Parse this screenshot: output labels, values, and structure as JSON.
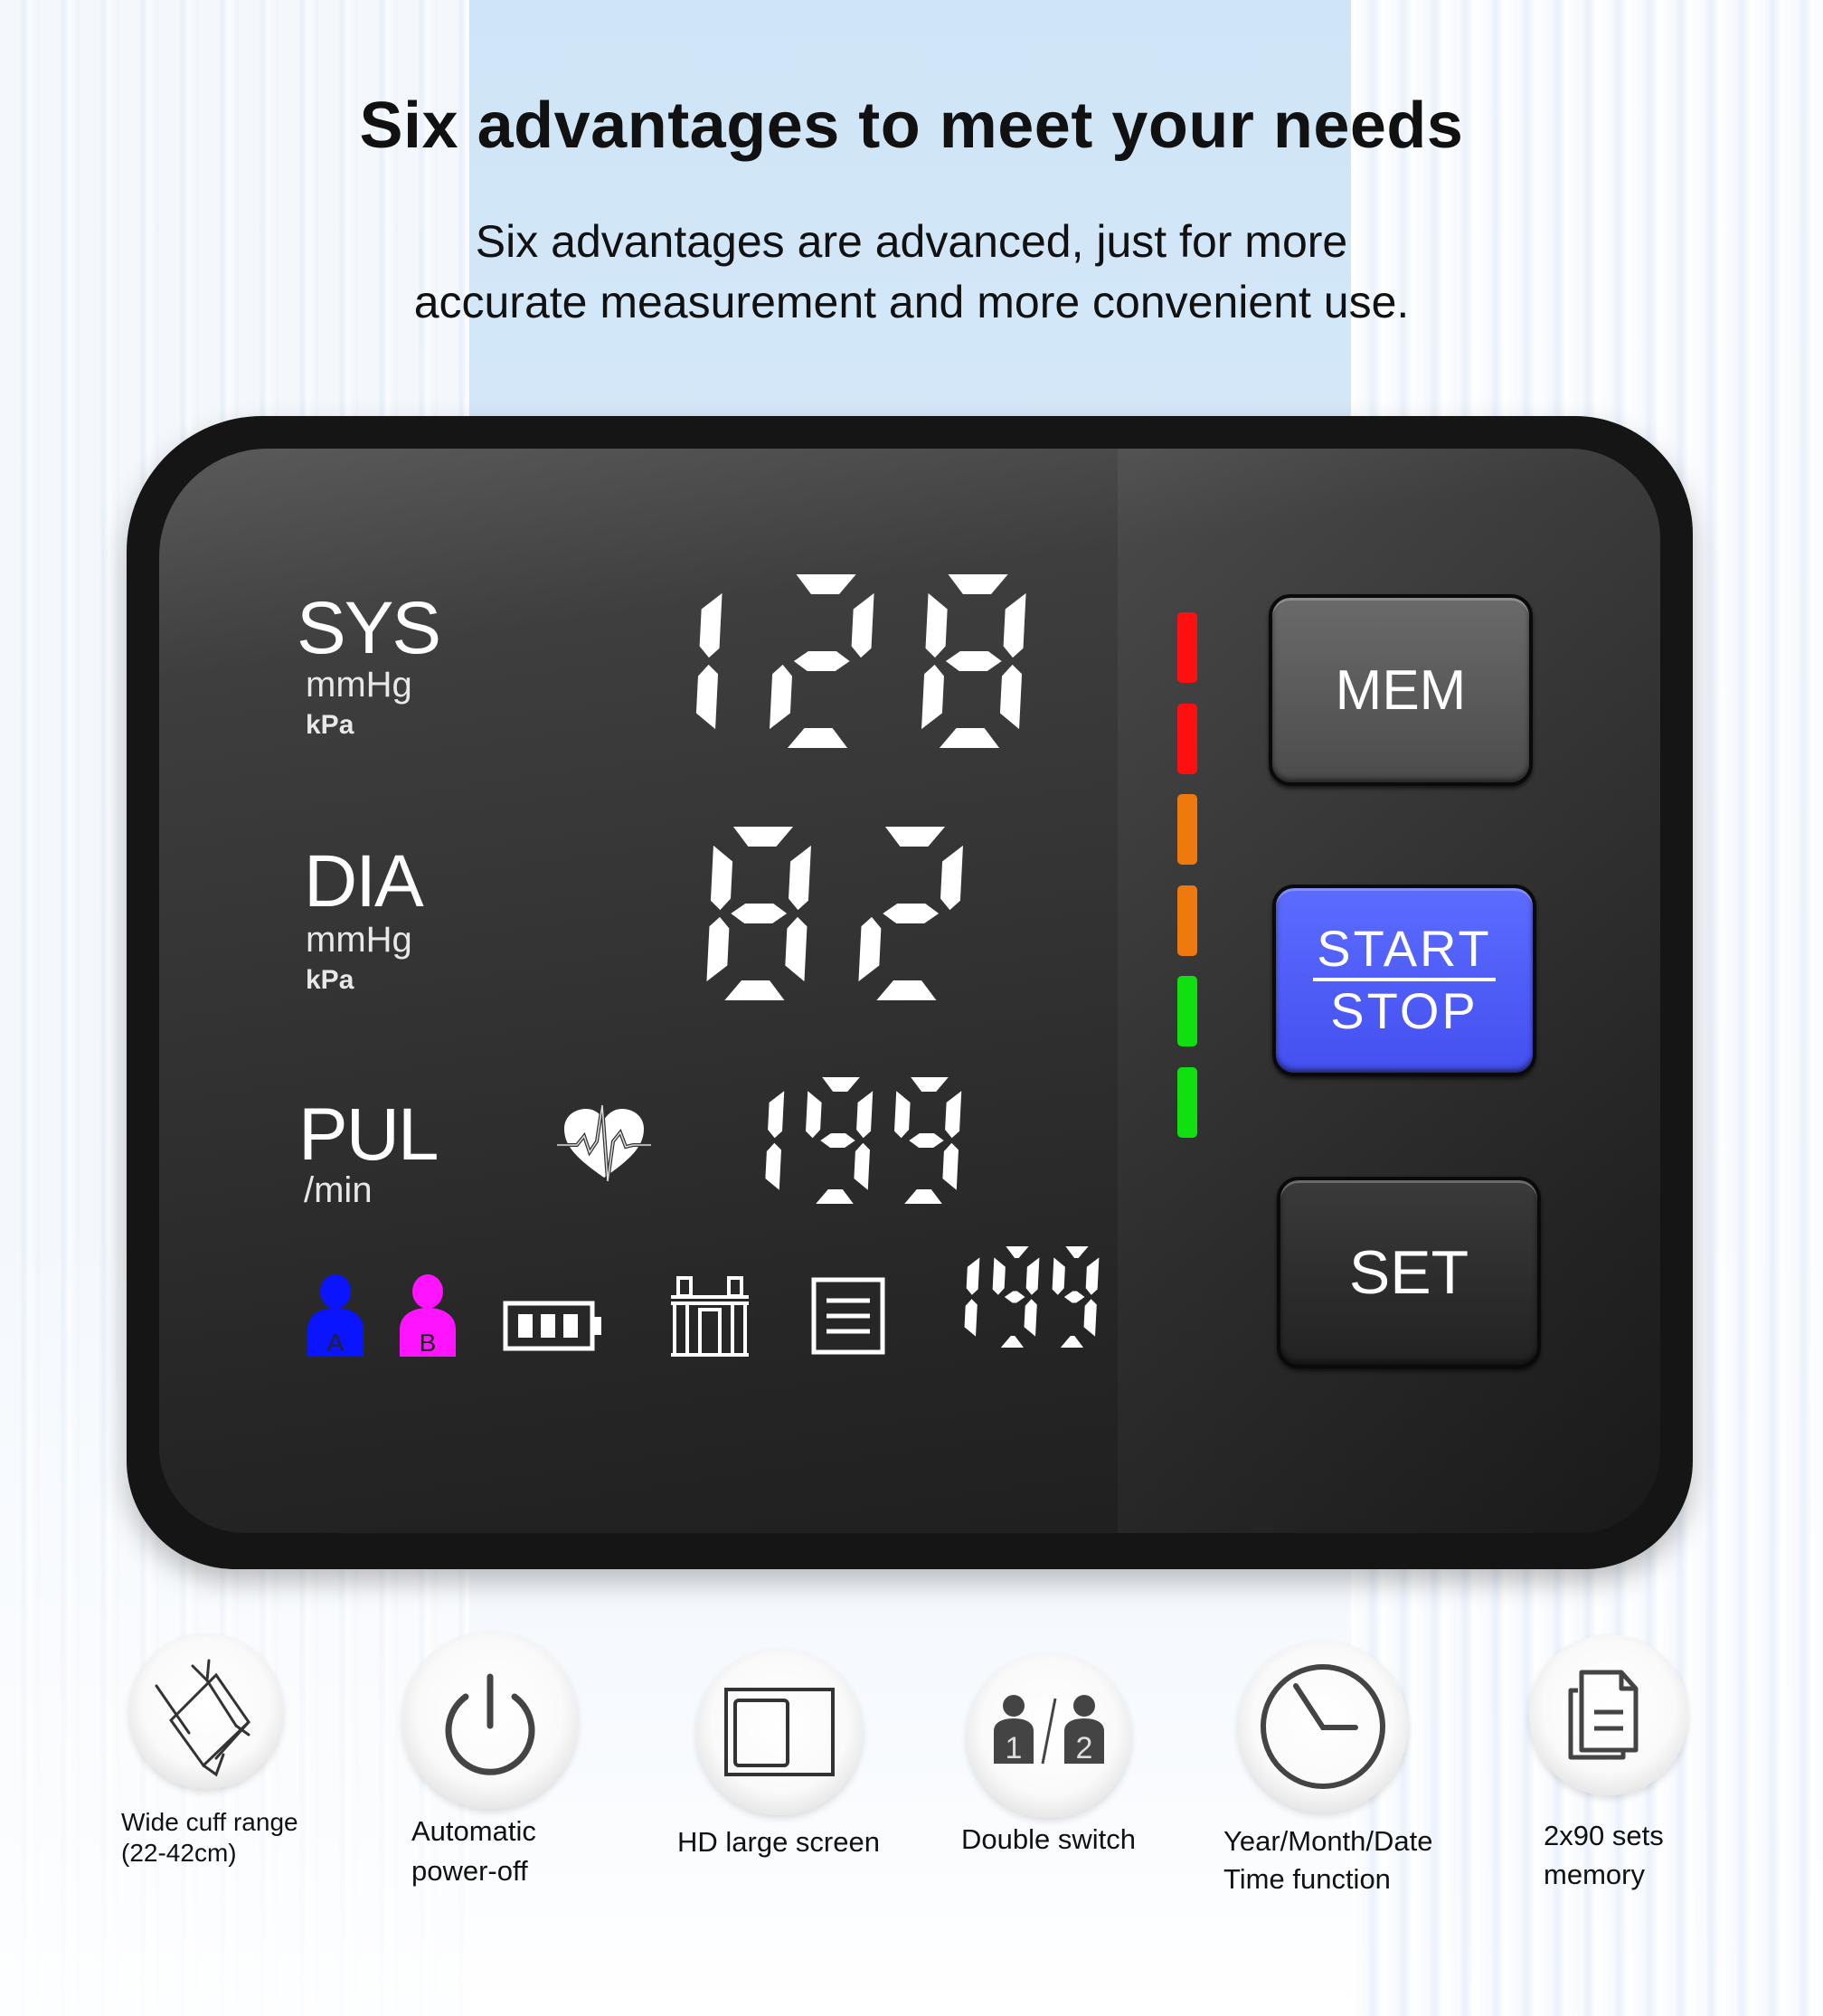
{
  "header": {
    "title": "Six advantages to meet your needs",
    "subtitle_line1": "Six advantages are advanced, just for more",
    "subtitle_line2": "accurate measurement and more convenient use."
  },
  "device": {
    "labels": {
      "sys": "SYS",
      "sys_unit": "mmHg",
      "sys_unit2": "kPa",
      "dia": "DIA",
      "dia_unit": "mmHg",
      "dia_unit2": "kPa",
      "pul": "PUL",
      "pul_unit": "/min"
    },
    "readings": {
      "systolic": "128",
      "diastolic": "82",
      "pulse": "199",
      "memory_index": "199"
    },
    "indicator_bar": {
      "segments": [
        "#ff1010",
        "#ff1010",
        "#ee7a0e",
        "#ee7a0e",
        "#10e010",
        "#10e010"
      ]
    },
    "user_icons": [
      {
        "label": "A",
        "color": "#0a14ff"
      },
      {
        "label": "B",
        "color": "#ff14ff"
      }
    ],
    "battery_level_bars": 3,
    "buttons": {
      "mem": "MEM",
      "start": "START",
      "stop": "STOP",
      "set": "SET"
    },
    "accent_color": "#4f5cf8"
  },
  "features": [
    {
      "icon": "cuff-icon",
      "line1": "Wide cuff range",
      "line2": "(22-42cm)"
    },
    {
      "icon": "power-icon",
      "line1": "Automatic",
      "line2": "power-off"
    },
    {
      "icon": "screen-icon",
      "line1": "HD large screen",
      "line2": ""
    },
    {
      "icon": "two-users-icon",
      "line1": "Double switch",
      "line2": ""
    },
    {
      "icon": "clock-icon",
      "line1": "Year/Month/Date",
      "line2": "Time function"
    },
    {
      "icon": "memory-documents-icon",
      "line1": "2x90 sets",
      "line2": "memory"
    }
  ]
}
